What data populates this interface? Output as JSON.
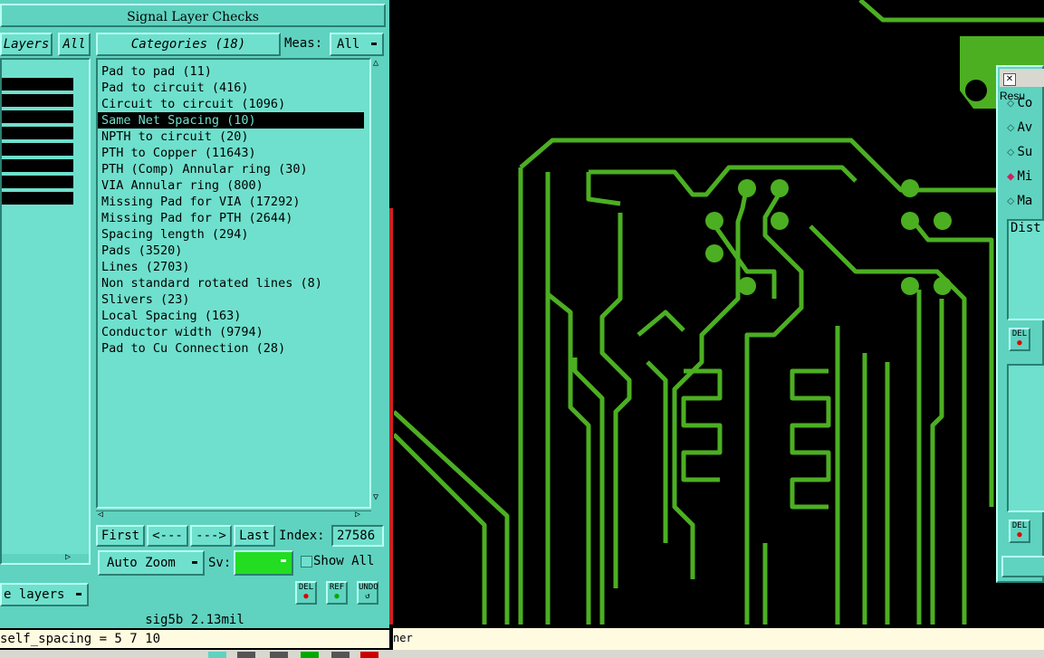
{
  "panel": {
    "title": "Signal Layer Checks",
    "layers_label": "Layers",
    "layers_all": "All",
    "categories_label": "Categories (18)",
    "meas_label": "Meas:",
    "meas_value": "All",
    "categories": [
      "Pad to pad (11)",
      "Pad to circuit (416)",
      "Circuit to circuit (1096)",
      "Same Net Spacing (10)",
      "NPTH to circuit (20)",
      "PTH to Copper (11643)",
      "PTH (Comp) Annular ring (30)",
      "VIA Annular ring (800)",
      "Missing Pad for VIA (17292)",
      "Missing Pad for PTH (2644)",
      "Spacing length (294)",
      "Pads (3520)",
      "Lines (2703)",
      "Non standard rotated lines (8)",
      "Slivers (23)",
      "Local Spacing (163)",
      "Conductor width (9794)",
      "Pad to Cu Connection (28)"
    ],
    "selected_index": 3,
    "nav": {
      "first": "First",
      "prev": "<---",
      "next": "--->",
      "last": "Last"
    },
    "index_label": "Index:",
    "index_value": "27586",
    "auto_zoom": "Auto Zoom",
    "sv_label": "Sv:",
    "sv_color": "#22dd22",
    "show_all": "Show All",
    "layers_dropdown": "e layers",
    "del_label": "DEL",
    "ref_label": "REF",
    "undo_label": "UNDO"
  },
  "status": {
    "layer_info": "sig5b 2.13mil",
    "command": "self_spacing = 5 7 10",
    "right_text": "ner"
  },
  "dialog": {
    "title": "Resu",
    "options": [
      "Co",
      "Av",
      "Su",
      "Mi",
      "Ma"
    ],
    "selected_option": 3,
    "field": "Dist",
    "del_label": "DEL"
  },
  "colors": {
    "panel_bg": "#5fd3c0",
    "trace": "#4caf22",
    "board_bg": "#000000",
    "status_bg": "#fffbe0"
  }
}
